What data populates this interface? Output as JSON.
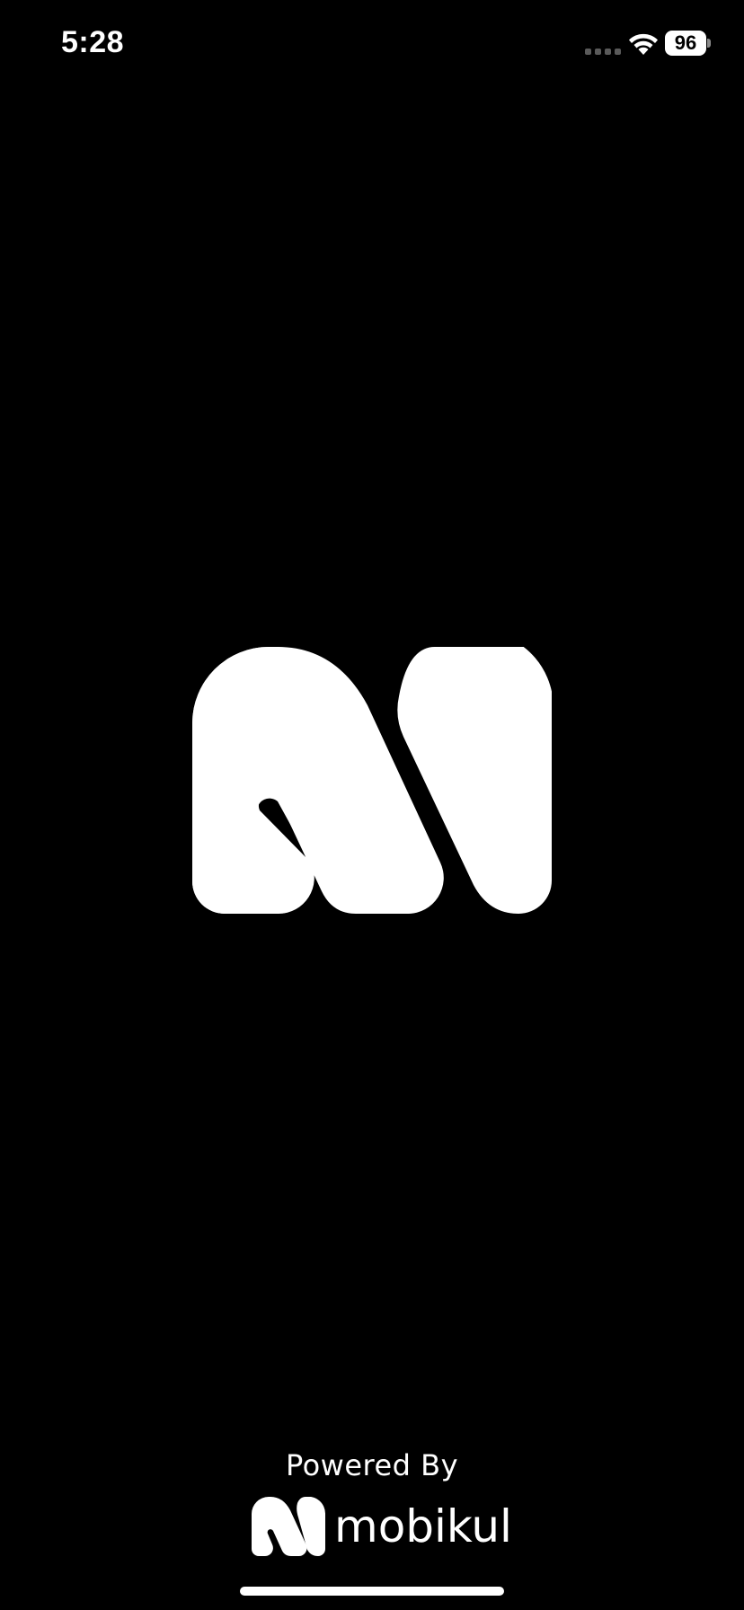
{
  "status_bar": {
    "time": "5:28",
    "battery_level": "96",
    "icons": [
      "signal-icon",
      "wifi-icon",
      "battery-icon"
    ]
  },
  "splash": {
    "logo_icon": "app-logo-icon"
  },
  "footer": {
    "powered_by": "Powered By",
    "brand_name": "mobikul",
    "brand_icon": "mobikul-logo-icon"
  },
  "colors": {
    "background": "#000000",
    "foreground": "#ffffff"
  }
}
